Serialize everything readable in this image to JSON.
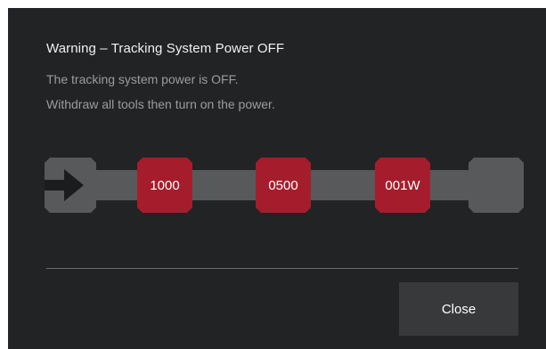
{
  "dialog": {
    "title": "Warning – Tracking System Power OFF",
    "message_line1": "The tracking system power is OFF.",
    "message_line2": "Withdraw all tools then turn on the power.",
    "close_label": "Close"
  },
  "track": {
    "markers": [
      "1000",
      "0500",
      "001W"
    ],
    "bar_color": "#58595b",
    "marker_color": "#a51d2c",
    "arrow_icon": "arrow-right-icon"
  },
  "colors": {
    "background": "#222324",
    "title_text": "#f1f1f1",
    "message_text": "#9b9c9e",
    "button_bg": "#38393b"
  }
}
